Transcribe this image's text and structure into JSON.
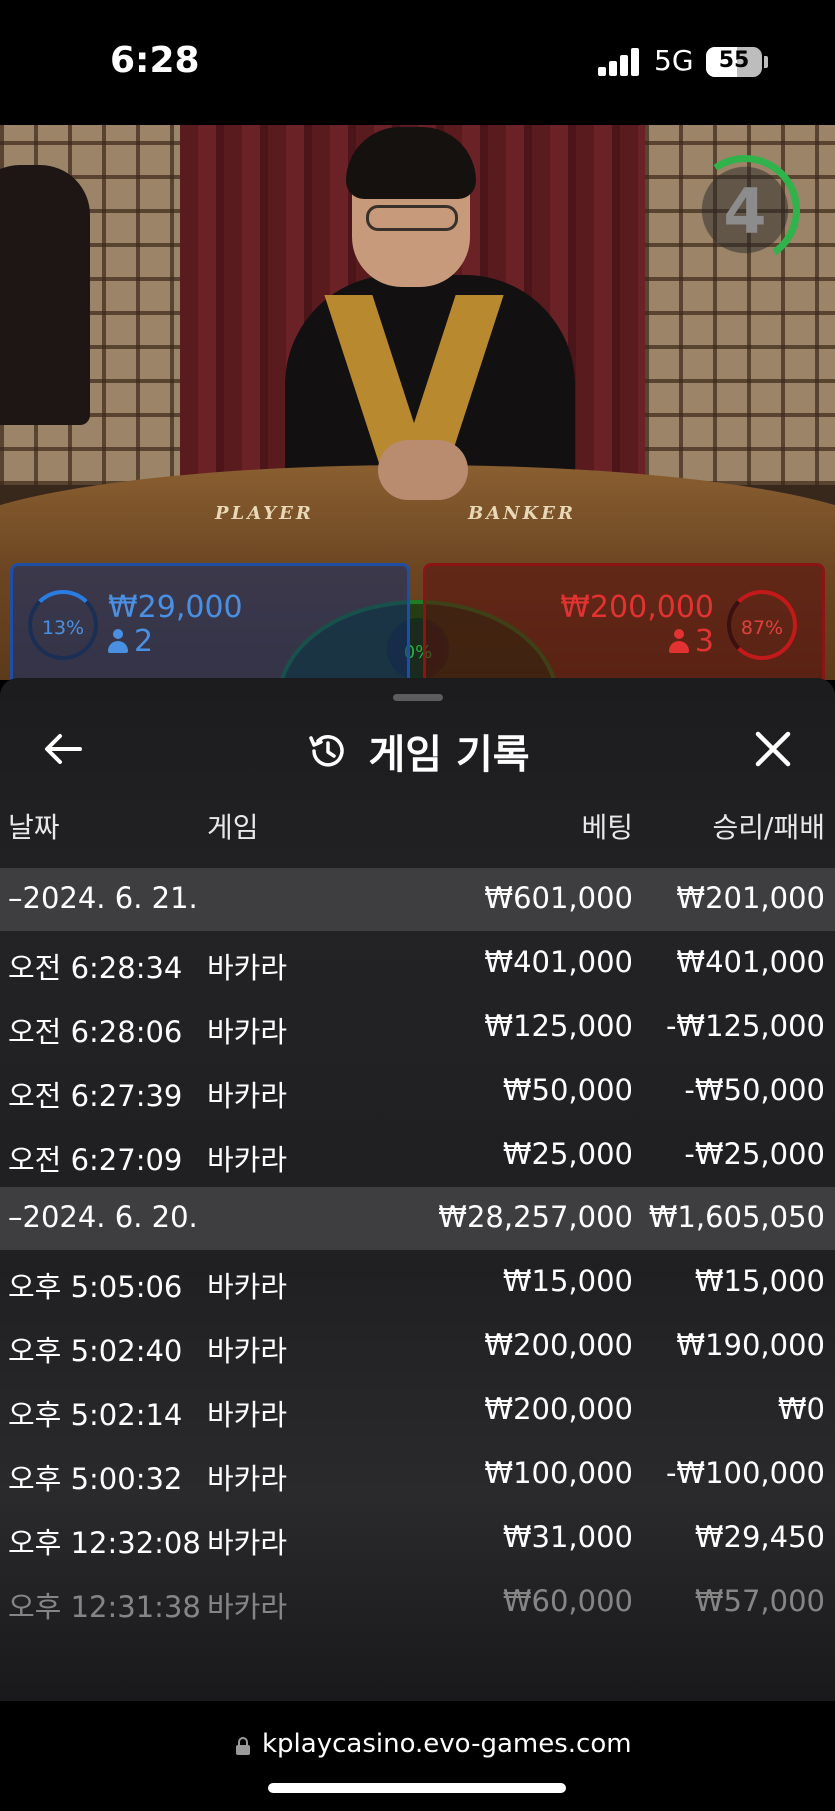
{
  "status_bar": {
    "time": "6:28",
    "network": "5G",
    "battery": "55",
    "battery_level": 0.55
  },
  "stream": {
    "timer": "4",
    "table_labels": {
      "player": "PLAYER",
      "banker": "BANKER"
    }
  },
  "bets": {
    "player": {
      "percent": "13%",
      "amount": "₩29,000",
      "players": "2",
      "color": "#4a90e2"
    },
    "tie": {
      "percent": "0%",
      "color": "#29b03b"
    },
    "banker": {
      "percent": "87%",
      "amount": "₩200,000",
      "players": "3",
      "color": "#e23232"
    }
  },
  "panel": {
    "title": "게임 기록",
    "icons": {
      "back": "arrow-left-icon",
      "history": "history-icon",
      "close": "close-icon"
    },
    "columns": {
      "date": "날짜",
      "game": "게임",
      "bet": "베팅",
      "win_loss": "승리/패배"
    },
    "groups": [
      {
        "date": "–2024. 6. 21.",
        "bet": "₩601,000",
        "win_loss": "₩201,000",
        "rows": [
          {
            "time": "오전 6:28:34",
            "game": "바카라",
            "bet": "₩401,000",
            "win_loss": "₩401,000"
          },
          {
            "time": "오전 6:28:06",
            "game": "바카라",
            "bet": "₩125,000",
            "win_loss": "-₩125,000"
          },
          {
            "time": "오전 6:27:39",
            "game": "바카라",
            "bet": "₩50,000",
            "win_loss": "-₩50,000"
          },
          {
            "time": "오전 6:27:09",
            "game": "바카라",
            "bet": "₩25,000",
            "win_loss": "-₩25,000"
          }
        ]
      },
      {
        "date": "–2024. 6. 20.",
        "bet": "₩28,257,000",
        "win_loss": "₩1,605,050",
        "rows": [
          {
            "time": "오후 5:05:06",
            "game": "바카라",
            "bet": "₩15,000",
            "win_loss": "₩15,000"
          },
          {
            "time": "오후 5:02:40",
            "game": "바카라",
            "bet": "₩200,000",
            "win_loss": "₩190,000"
          },
          {
            "time": "오후 5:02:14",
            "game": "바카라",
            "bet": "₩200,000",
            "win_loss": "₩0"
          },
          {
            "time": "오후 5:00:32",
            "game": "바카라",
            "bet": "₩100,000",
            "win_loss": "-₩100,000"
          },
          {
            "time": "오후 12:32:08",
            "game": "바카라",
            "bet": "₩31,000",
            "win_loss": "₩29,450"
          },
          {
            "time": "오후 12:31:38",
            "game": "바카라",
            "bet": "₩60,000",
            "win_loss": "₩57,000"
          }
        ]
      }
    ]
  },
  "browser": {
    "url": "kplaycasino.evo-games.com"
  }
}
